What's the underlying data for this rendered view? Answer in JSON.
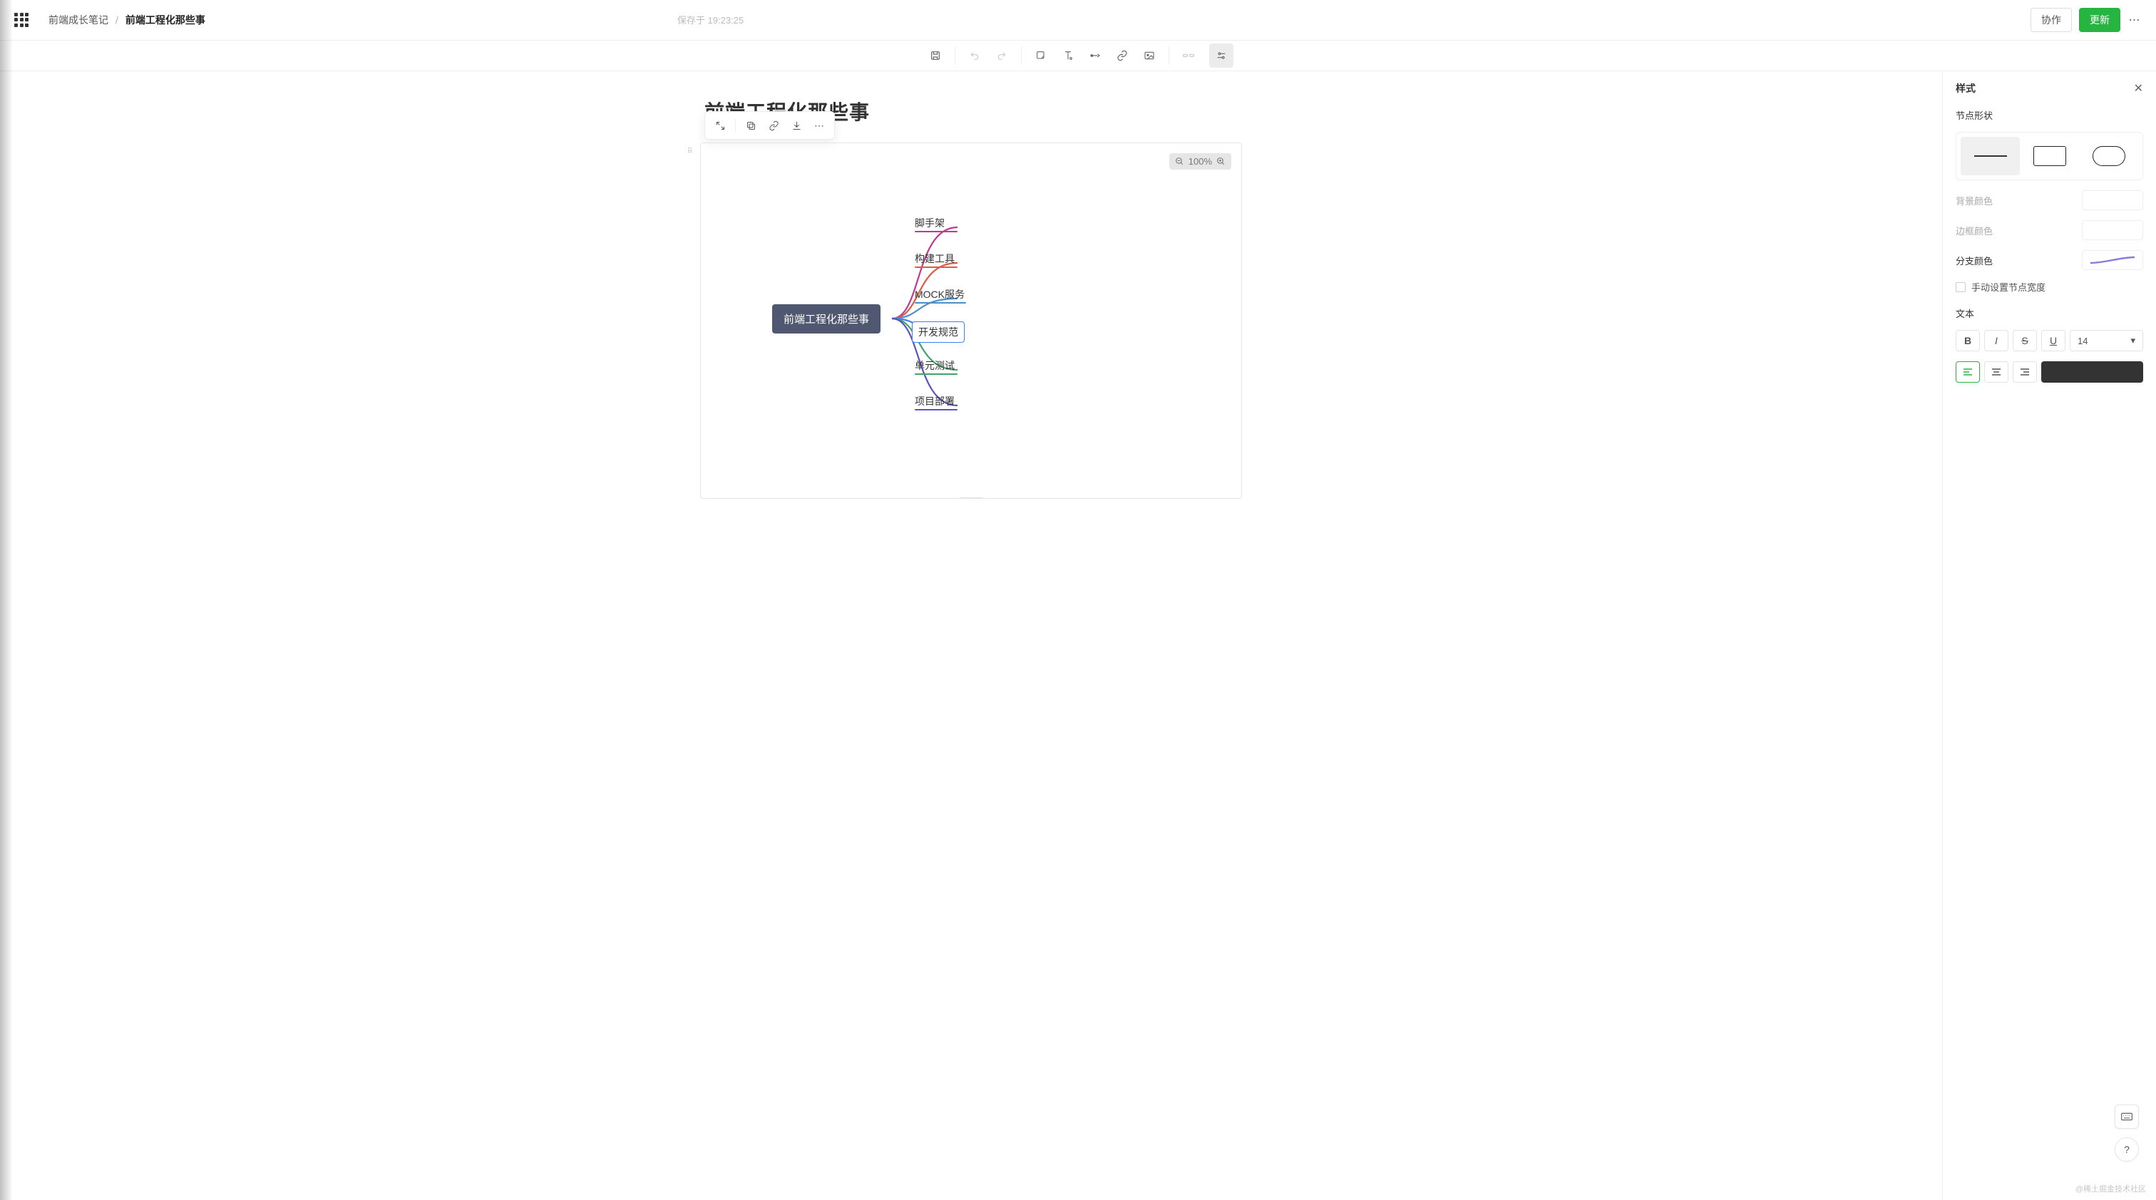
{
  "header": {
    "folder": "前端成长笔记",
    "doc": "前端工程化那些事",
    "saved_prefix": "保存于",
    "saved_time": "19:23:25",
    "collab_label": "协作",
    "update_label": "更新"
  },
  "toolbar": {
    "save": "保存",
    "undo": "撤销",
    "redo": "重做",
    "shape": "形状",
    "textshape": "文字形状",
    "connector": "连接",
    "link": "链接",
    "image": "图片",
    "break": "分隔",
    "styles": "样式"
  },
  "doc": {
    "title": "前端工程化那些事"
  },
  "zoom": {
    "value": "100%"
  },
  "mindmap": {
    "root": "前端工程化那些事",
    "children": [
      {
        "label": "脚手架",
        "color": "#c0398f",
        "selected": false
      },
      {
        "label": "构建工具",
        "color": "#e05a3f",
        "selected": false
      },
      {
        "label": "MOCK服务",
        "color": "#4a91c9",
        "selected": false
      },
      {
        "label": "开发规范",
        "color": "#3b82f6",
        "selected": true
      },
      {
        "label": "单元测试",
        "color": "#3fa36a",
        "selected": false
      },
      {
        "label": "项目部署",
        "color": "#5a52c7",
        "selected": false
      }
    ]
  },
  "sidepanel": {
    "title": "样式",
    "shape_label": "节点形状",
    "bg_label": "背景颜色",
    "border_label": "边框颜色",
    "branch_label": "分支颜色",
    "branch_color": "#8a7ae0",
    "manual_width_label": "手动设置节点宽度",
    "text_label": "文本",
    "bold": "B",
    "italic": "I",
    "strike": "S",
    "underline": "U",
    "font_size": "14",
    "text_color": "#333333"
  },
  "footer": {
    "watermark": "@稀土掘金技术社区"
  }
}
